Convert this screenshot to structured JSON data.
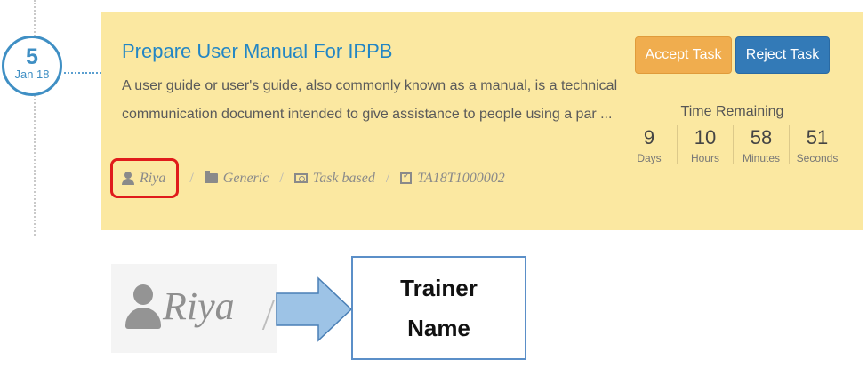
{
  "timeline": {
    "day": "5",
    "month": "Jan 18"
  },
  "task": {
    "title": "Prepare User Manual For IPPB",
    "description_line1": "A user guide or user's guide, also commonly known as a manual, is a technical",
    "description_line2": "communication document intended to give assistance to people using a par ...",
    "accept_label": "Accept Task",
    "reject_label": "Reject Task",
    "time_remaining_label": "Time Remaining",
    "time": [
      {
        "value": "9",
        "unit": "Days"
      },
      {
        "value": "10",
        "unit": "Hours"
      },
      {
        "value": "58",
        "unit": "Minutes"
      },
      {
        "value": "51",
        "unit": "Seconds"
      }
    ],
    "meta": {
      "trainer": "Riya",
      "category": "Generic",
      "type": "Task based",
      "task_id": "TA18T1000002",
      "separator": "/"
    }
  },
  "annotation": {
    "zoom_name": "Riya",
    "callout_line1": "Trainer",
    "callout_line2": "Name"
  },
  "icons": [
    "person-icon",
    "folder-icon",
    "money-icon",
    "check-square-icon",
    "right-arrow-icon"
  ],
  "colors": {
    "card_bg": "#fbe8a1",
    "title": "#2386c4",
    "accept": "#f0ad4e",
    "reject": "#337ab7",
    "highlight": "#e01b1b",
    "arrow_fill": "#9dc3e6"
  }
}
